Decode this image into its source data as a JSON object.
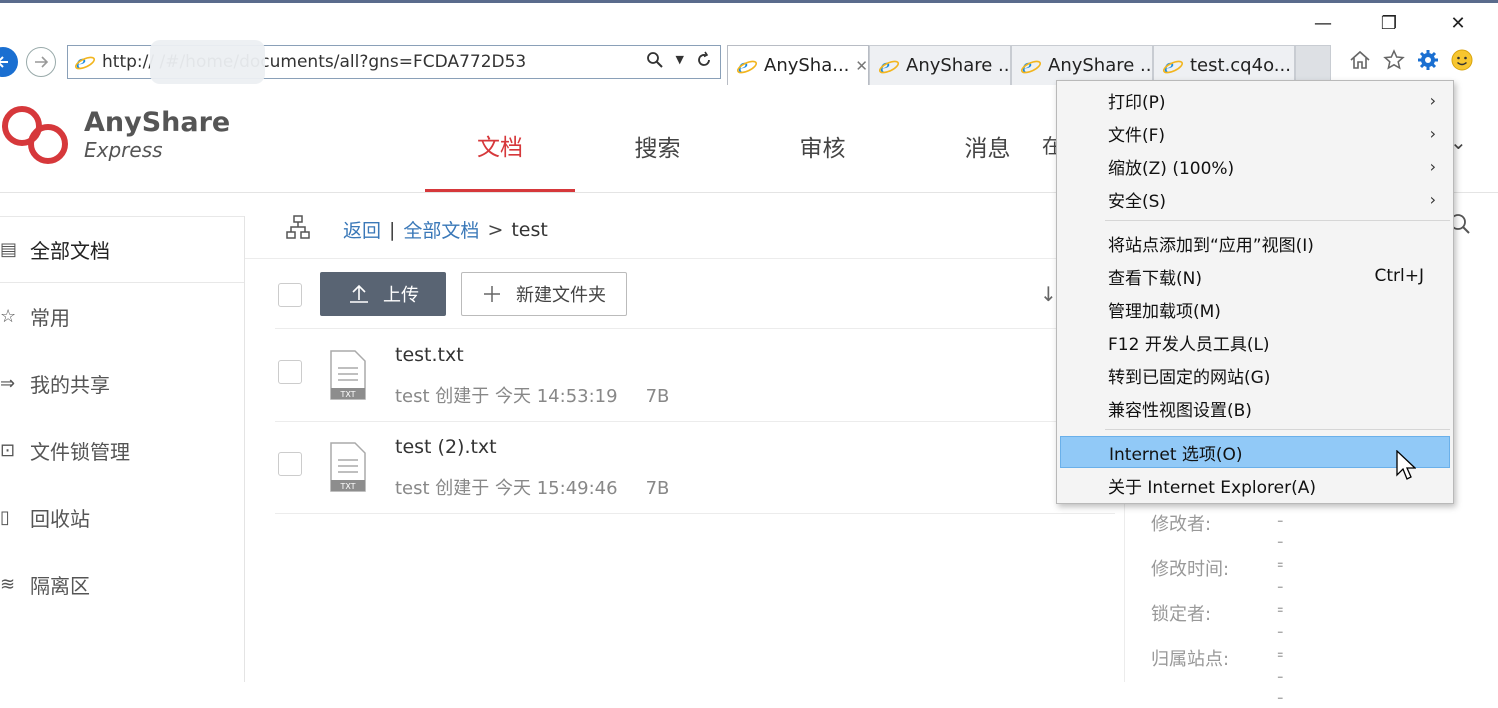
{
  "window": {
    "minimize_glyph": "—",
    "restore_glyph": "❐",
    "close_glyph": "✕"
  },
  "browser": {
    "address": "http://                    /#/home/documents/all?gns=FCDA772D53",
    "tabs": [
      {
        "title": "AnySha...",
        "active": true,
        "close": "✕"
      },
      {
        "title": "AnyShare ..."
      },
      {
        "title": "AnyShare ..."
      },
      {
        "title": "test.cq4o..."
      }
    ]
  },
  "app": {
    "logo_main": "AnyShare",
    "logo_sub": "Express",
    "nav": [
      "文档",
      "搜索",
      "审核",
      "消息"
    ],
    "nav_overflow_fragment": "在",
    "sidebar": [
      "全部文档",
      "常用",
      "我的共享",
      "文件锁管理",
      "回收站",
      "隔离区"
    ],
    "breadcrumb": {
      "back": "返回",
      "root": "全部文档",
      "sep": ">",
      "current": "test"
    },
    "toolbar": {
      "upload": "上传",
      "new_folder": "新建文件夹"
    },
    "files": [
      {
        "name": "test.txt",
        "meta": "test 创建于 今天 14:53:19",
        "size": "7B",
        "ext": "TXT"
      },
      {
        "name": "test (2).txt",
        "meta": "test 创建于 今天 15:49:46",
        "size": "7B",
        "ext": "TXT"
      }
    ],
    "detail": [
      {
        "label": "修改者:",
        "value": "---"
      },
      {
        "label": "修改时间:",
        "value": "---"
      },
      {
        "label": "锁定者:",
        "value": "---"
      },
      {
        "label": "归属站点:",
        "value": "---"
      }
    ]
  },
  "menu": {
    "items": [
      {
        "label": "打印(P)",
        "arrow": "›"
      },
      {
        "label": "文件(F)",
        "arrow": "›"
      },
      {
        "label": "缩放(Z) (100%)",
        "arrow": "›"
      },
      {
        "label": "安全(S)",
        "arrow": "›"
      },
      {
        "label": "将站点添加到“应用”视图(I)"
      },
      {
        "label": "查看下载(N)",
        "shortcut": "Ctrl+J"
      },
      {
        "label": "管理加载项(M)"
      },
      {
        "label": "F12 开发人员工具(L)"
      },
      {
        "label": "转到已固定的网站(G)"
      },
      {
        "label": "兼容性视图设置(B)"
      },
      {
        "label": "Internet 选项(O)",
        "highlighted": true
      },
      {
        "label": "关于 Internet Explorer(A)"
      }
    ]
  },
  "colors": {
    "accent": "#d6383b",
    "link": "#3a78b8",
    "upload_bg": "#596473",
    "menu_highlight": "#91c9f7"
  }
}
